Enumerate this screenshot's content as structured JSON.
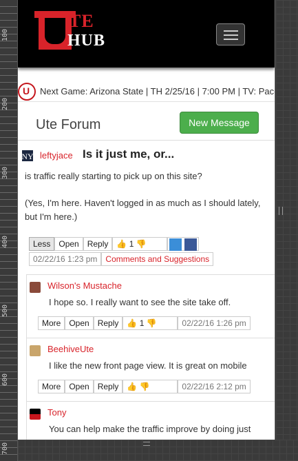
{
  "ruler": {
    "labels": [
      "100",
      "200",
      "300",
      "400",
      "500",
      "600",
      "700"
    ]
  },
  "header": {
    "logo_top": "TE",
    "logo_bottom": "HUB",
    "menu_icon": "hamburger-icon"
  },
  "ticker": {
    "text": "Next Game: Arizona State | TH 2/25/16 | 7:00 PM | TV: Pac-"
  },
  "forum": {
    "title": "Ute Forum",
    "new_message_label": "New Message"
  },
  "post": {
    "author": "leftyjace",
    "title": "Is it just me, or...",
    "body": [
      "is traffic really starting to pick up on this site?",
      "(Yes, I'm here. Haven't logged in as much as I should lately, but I'm here.)"
    ],
    "buttons": {
      "less": "Less",
      "open": "Open",
      "reply": "Reply",
      "likes": "1"
    },
    "date": "02/22/16 1:23 pm",
    "category": "Comments and Suggestions"
  },
  "replies": [
    {
      "author": "Wilson's Mustache",
      "body": "I hope so. I really want to see the site take off.",
      "more": "More",
      "open": "Open",
      "reply": "Reply",
      "likes": "1",
      "date": "02/22/16 1:26 pm"
    },
    {
      "author": "BeehiveUte",
      "body": "I like the new front page view. It is great on mobile",
      "more": "More",
      "open": "Open",
      "reply": "Reply",
      "likes": "",
      "date": "02/22/16 2:12 pm"
    },
    {
      "author": "Tony",
      "body": "You can help make the traffic improve by doing just"
    }
  ],
  "colors": {
    "brand_red": "#d8232a",
    "green": "#4cae4c",
    "black": "#000000"
  }
}
